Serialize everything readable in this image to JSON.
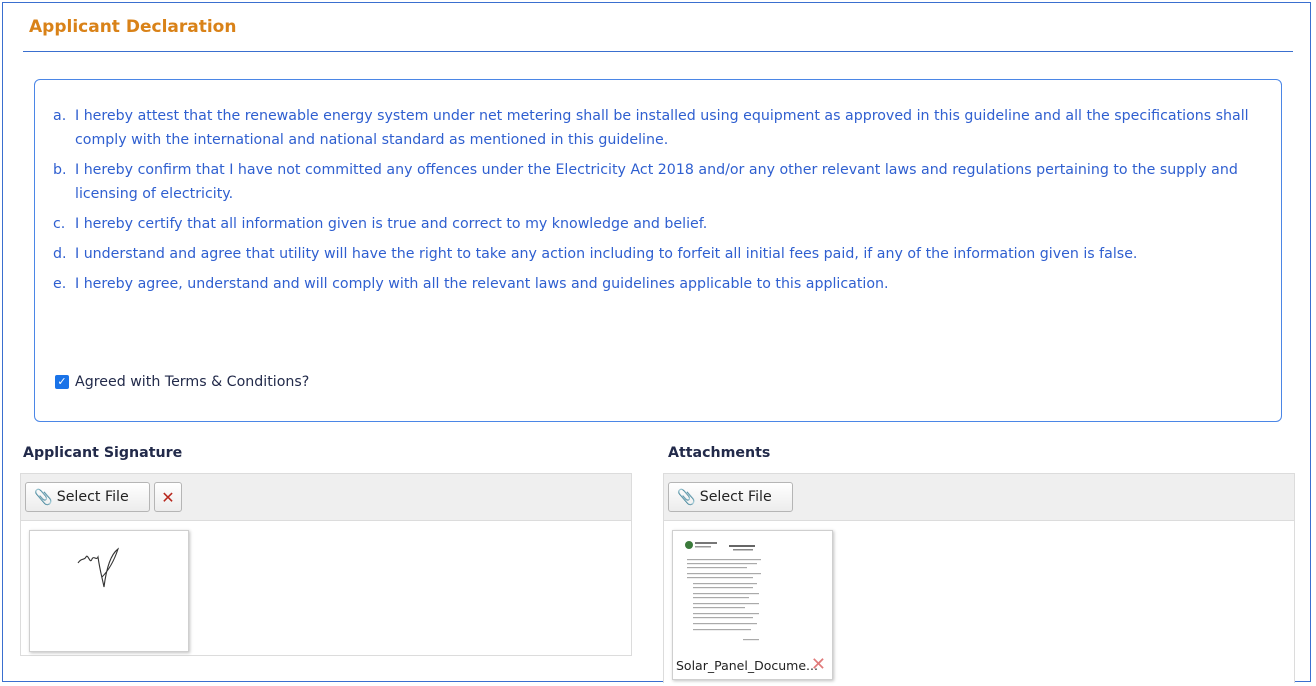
{
  "header": {
    "title": "Applicant Declaration"
  },
  "declaration": {
    "items": [
      {
        "letter": "a.",
        "text": "I hereby attest that the renewable energy system under net metering shall be installed using equipment as approved in this guideline and all the specifications shall comply with the international and national standard as mentioned in this guideline."
      },
      {
        "letter": "b.",
        "text": "I hereby confirm that I have not committed any offences under the Electricity Act 2018 and/or any other relevant laws and regulations pertaining to the supply and licensing of electricity."
      },
      {
        "letter": "c.",
        "text": "I hereby certify that all information given is true and correct to my knowledge and belief."
      },
      {
        "letter": "d.",
        "text": "I understand and agree that utility will have the right to take any action including to forfeit all initial fees paid, if any of the information given is false."
      },
      {
        "letter": "e.",
        "text": "I hereby agree, understand and will comply with all the relevant laws and guidelines applicable to this application."
      }
    ],
    "agree_label": "Agreed with Terms & Conditions?",
    "agree_checked": true
  },
  "signature": {
    "label": "Applicant Signature",
    "select_label": "Select File"
  },
  "attachments": {
    "label": "Attachments",
    "select_label": "Select File",
    "file_name": "Solar_Panel_Docume..."
  },
  "colors": {
    "accent_title": "#d98218",
    "declaration_text": "#2f5fd0",
    "border_blue": "#3a6fcf",
    "checkbox": "#1a73e8",
    "remove_red": "#b8281e"
  }
}
